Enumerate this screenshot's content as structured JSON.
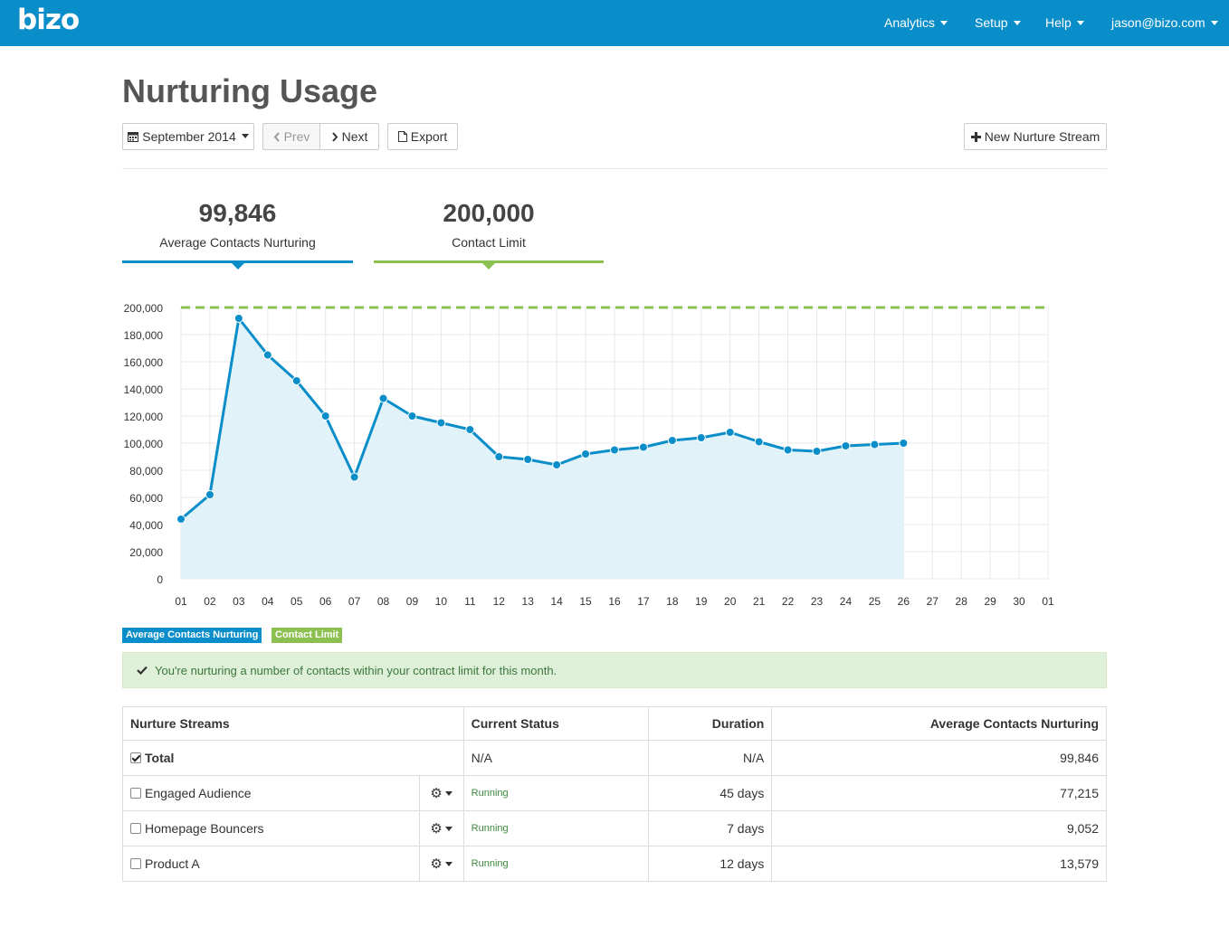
{
  "header": {
    "logo": "bizo",
    "nav": [
      "Analytics",
      "Setup",
      "Help",
      "jason@bizo.com"
    ]
  },
  "page_title": "Nurturing Usage",
  "toolbar": {
    "month": "September 2014",
    "prev": "Prev",
    "next": "Next",
    "export": "Export",
    "new_stream": "New Nurture Stream"
  },
  "stats": {
    "avg_value": "99,846",
    "avg_label": "Average Contacts Nurturing",
    "limit_value": "200,000",
    "limit_label": "Contact Limit"
  },
  "colors": {
    "primary": "#0a8ec9",
    "limit": "#8cc152",
    "area": "#e1f2f8"
  },
  "chart_data": {
    "type": "area",
    "x": [
      "01",
      "02",
      "03",
      "04",
      "05",
      "06",
      "07",
      "08",
      "09",
      "10",
      "11",
      "12",
      "13",
      "14",
      "15",
      "16",
      "17",
      "18",
      "19",
      "20",
      "21",
      "22",
      "23",
      "24",
      "25",
      "26",
      "27",
      "28",
      "29",
      "30",
      "01"
    ],
    "ylim": [
      0,
      200000
    ],
    "yticks": [
      "0",
      "20,000",
      "40,000",
      "60,000",
      "80,000",
      "100,000",
      "120,000",
      "140,000",
      "160,000",
      "180,000",
      "200,000"
    ],
    "series": [
      {
        "name": "Average Contacts Nurturing",
        "values": [
          44000,
          62000,
          192000,
          165000,
          146000,
          120000,
          75000,
          133000,
          120000,
          115000,
          110000,
          90000,
          88000,
          84000,
          92000,
          95000,
          97000,
          102000,
          104000,
          108000,
          101000,
          95000,
          94000,
          98000,
          99000,
          100000
        ]
      },
      {
        "name": "Contact Limit",
        "values": [
          200000,
          200000,
          200000,
          200000,
          200000,
          200000,
          200000,
          200000,
          200000,
          200000,
          200000,
          200000,
          200000,
          200000,
          200000,
          200000,
          200000,
          200000,
          200000,
          200000,
          200000,
          200000,
          200000,
          200000,
          200000,
          200000,
          200000,
          200000,
          200000,
          200000,
          200000
        ]
      }
    ],
    "grid": true
  },
  "legend": [
    "Average Contacts Nurturing",
    "Contact Limit"
  ],
  "alert": "You're nurturing a number of contacts within your contract limit for this month.",
  "table": {
    "headers": [
      "Nurture Streams",
      "Current Status",
      "Duration",
      "Average Contacts Nurturing"
    ],
    "rows": [
      {
        "name": "Total",
        "status": "N/A",
        "duration": "N/A",
        "avg": "99,846"
      },
      {
        "name": "Engaged Audience",
        "status": "Running",
        "duration": "45 days",
        "avg": "77,215"
      },
      {
        "name": "Homepage Bouncers",
        "status": "Running",
        "duration": "7 days",
        "avg": "9,052"
      },
      {
        "name": "Product A",
        "status": "Running",
        "duration": "12 days",
        "avg": "13,579"
      }
    ]
  }
}
